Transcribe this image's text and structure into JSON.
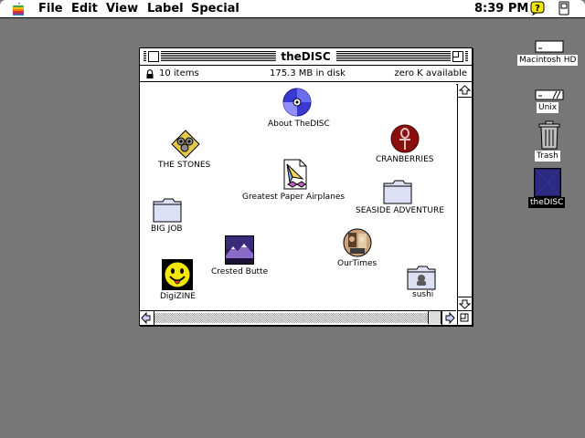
{
  "menubar": {
    "menus": [
      "File",
      "Edit",
      "View",
      "Label",
      "Special"
    ],
    "clock": "8:39 PM"
  },
  "window": {
    "title": "theDISC",
    "info": {
      "items": "10 items",
      "disk": "175.3 MB in disk",
      "available": "zero K available"
    },
    "icons": [
      {
        "label": "About TheDISC",
        "icon": "cd-disc-icon"
      },
      {
        "label": "THE STONES",
        "icon": "stones-app-icon"
      },
      {
        "label": "CRANBERRIES",
        "icon": "ankh-icon"
      },
      {
        "label": "Greatest Paper Airplanes",
        "icon": "paper-airplane-doc-icon"
      },
      {
        "label": "BIG JOB",
        "icon": "folder-icon"
      },
      {
        "label": "SEASIDE ADVENTURE",
        "icon": "folder-icon"
      },
      {
        "label": "Crested Butte",
        "icon": "mountain-picture-icon"
      },
      {
        "label": "OurTimes",
        "icon": "faces-icon"
      },
      {
        "label": "DigiZINE",
        "icon": "smiley-icon"
      },
      {
        "label": "sushi",
        "icon": "folder-icon"
      }
    ]
  },
  "desktop": {
    "icons": [
      {
        "label": "Macintosh HD",
        "icon": "hard-disk-icon"
      },
      {
        "label": "Unix",
        "icon": "hard-disk-icon"
      },
      {
        "label": "Trash",
        "icon": "trash-icon"
      },
      {
        "label": "theDISC",
        "icon": "cd-volume-icon",
        "selected": true
      }
    ]
  },
  "colors": {
    "desktop": "#777777",
    "disc_blue": "#3a3ad0",
    "ankh_red": "#8a1010",
    "smiley_yellow": "#f2e800"
  }
}
